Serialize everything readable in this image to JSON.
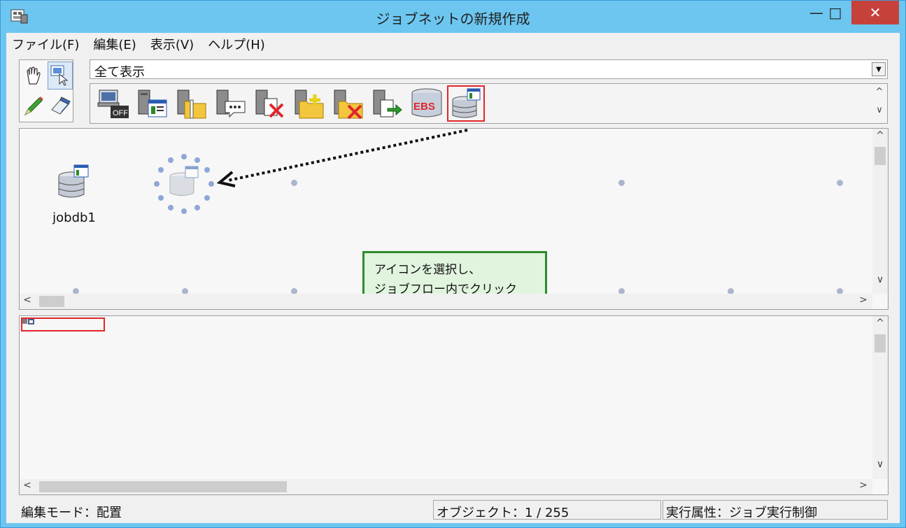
{
  "window": {
    "title": "ジョブネットの新規作成"
  },
  "menubar": {
    "items": [
      "ファイル(F)",
      "編集(E)",
      "表示(V)",
      "ヘルプ(H)"
    ]
  },
  "filter": {
    "selected": "全て表示"
  },
  "palette": {
    "tools": [
      "hand-icon",
      "select-cursor-icon",
      "pencil-icon",
      "eraser-icon"
    ]
  },
  "toolbar": {
    "icons": [
      "power-off-host-icon",
      "server-job-list-icon",
      "server-zip-folder-icon",
      "server-message-icon",
      "server-delete-icon",
      "folder-add-icon",
      "folder-delete-icon",
      "server-export-icon",
      "ebs-database-icon",
      "jobdb-icon"
    ],
    "selected_index": 9,
    "ebs_label": "EBS"
  },
  "flow": {
    "placed_job": {
      "label": "jobdb1"
    },
    "callout": {
      "line1": "アイコンを選択し、",
      "line2": "ジョブフロー内でクリック"
    }
  },
  "status": {
    "mode": "編集モード：配置",
    "objects": "オブジェクト：1 / 255",
    "attribute": "実行属性：ジョブ実行制御"
  },
  "colors": {
    "title_bar": "#6cc6f0",
    "close_button": "#c7413b",
    "highlight": "#e0262c",
    "callout_border": "#2f8a2f",
    "callout_bg": "#e1f5de"
  }
}
